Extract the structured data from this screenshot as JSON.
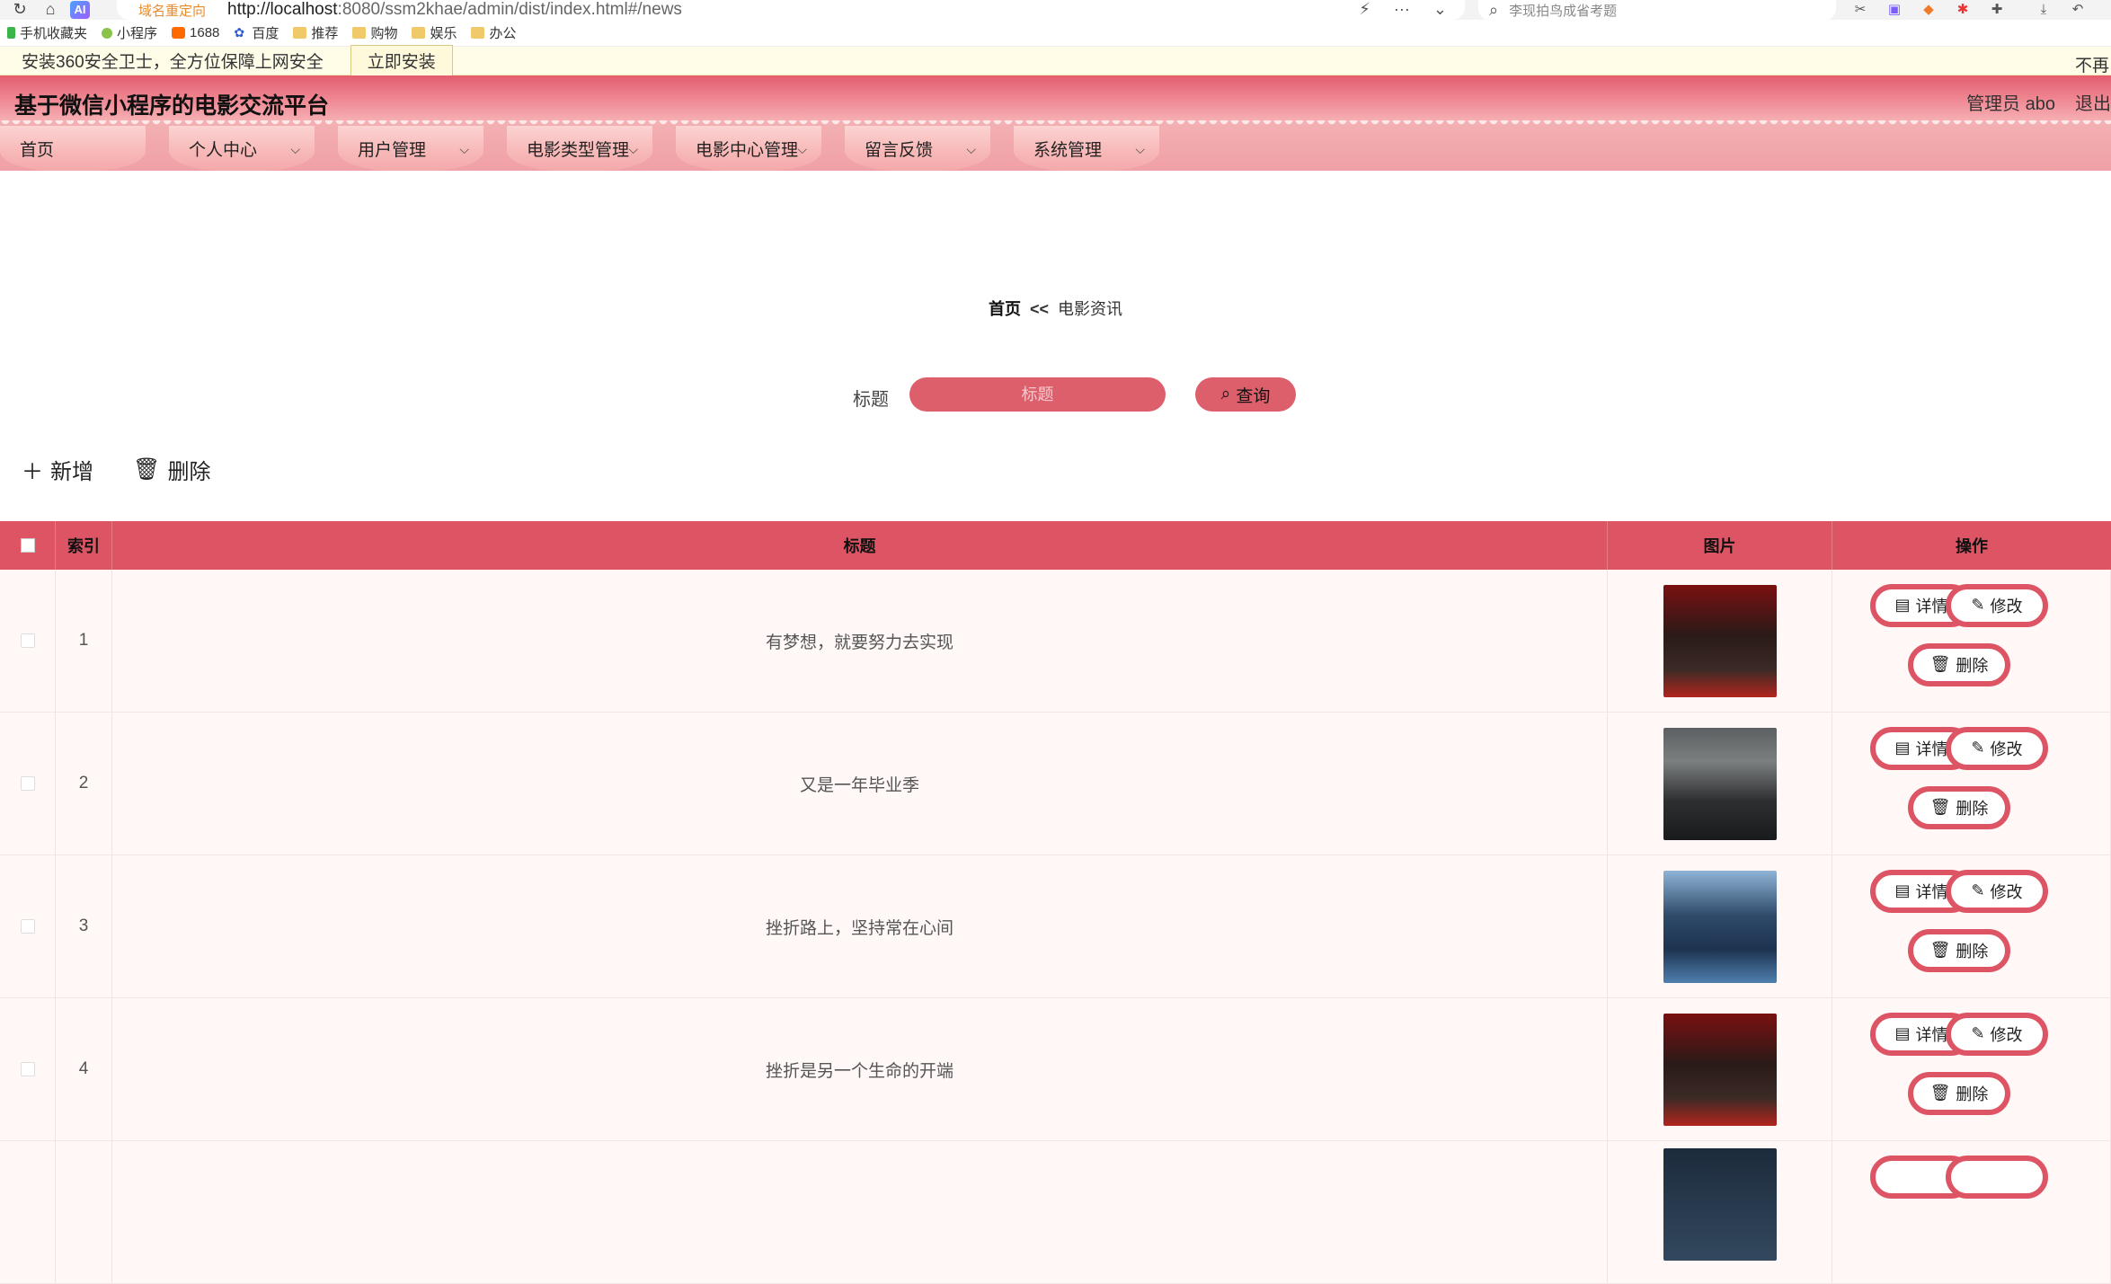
{
  "browser": {
    "redirect_tag": "域名重定向",
    "url_host": "http://localhost",
    "url_rest": ":8080/ssm2khae/admin/dist/index.html#/news",
    "search_placeholder": "李现拍鸟成省考题"
  },
  "bookmarks": [
    {
      "label": "手机收藏夹",
      "icon": "phone-icon"
    },
    {
      "label": "小程序",
      "icon": "miniapp-icon"
    },
    {
      "label": "1688",
      "icon": "1688-icon"
    },
    {
      "label": "百度",
      "icon": "baidu-icon"
    },
    {
      "label": "推荐",
      "icon": "folder-icon"
    },
    {
      "label": "购物",
      "icon": "folder-icon"
    },
    {
      "label": "娱乐",
      "icon": "folder-icon"
    },
    {
      "label": "办公",
      "icon": "folder-icon"
    }
  ],
  "notice": {
    "text": "安装360安全卫士，全方位保障上网安全",
    "button": "立即安装",
    "close": "不再"
  },
  "header": {
    "title": "基于微信小程序的电影交流平台",
    "user": "管理员 abo",
    "logout": "退出"
  },
  "nav": [
    {
      "label": "首页",
      "has_menu": false
    },
    {
      "label": "个人中心",
      "has_menu": true
    },
    {
      "label": "用户管理",
      "has_menu": true
    },
    {
      "label": "电影类型管理",
      "has_menu": true
    },
    {
      "label": "电影中心管理",
      "has_menu": true
    },
    {
      "label": "留言反馈",
      "has_menu": true
    },
    {
      "label": "系统管理",
      "has_menu": true
    }
  ],
  "breadcrumb": {
    "home": "首页",
    "sep": "<<",
    "current": "电影资讯"
  },
  "search": {
    "label": "标题",
    "placeholder": "标题",
    "button": "查询"
  },
  "toolbar": {
    "add": "新增",
    "delete": "删除"
  },
  "table": {
    "headers": {
      "index": "索引",
      "title": "标题",
      "image": "图片",
      "actions": "操作"
    },
    "actions": {
      "detail": "详情",
      "edit": "修改",
      "delete": "删除"
    },
    "rows": [
      {
        "index": "1",
        "title": "有梦想，就要努力去实现"
      },
      {
        "index": "2",
        "title": "又是一年毕业季"
      },
      {
        "index": "3",
        "title": "挫折路上，坚持常在心间"
      },
      {
        "index": "4",
        "title": "挫折是另一个生命的开端"
      }
    ]
  },
  "colors": {
    "primary": "#dd5565",
    "header_pink": "#f18f99",
    "row_bg": "#fff8f7"
  }
}
